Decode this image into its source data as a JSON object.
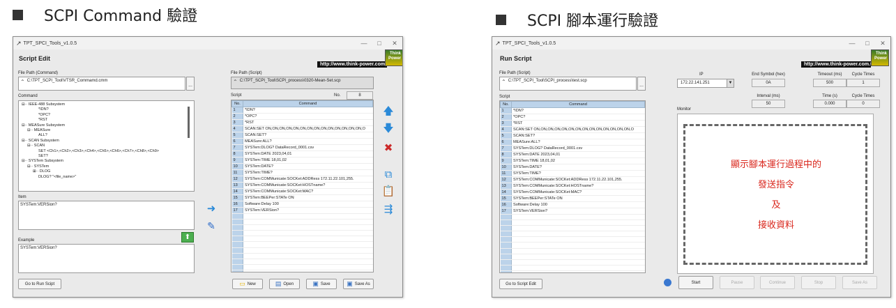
{
  "headings": {
    "left": "SCPI Command 驗證",
    "right": "SCPI 腳本運行驗證"
  },
  "common": {
    "app_title": "TPT_SPCI_Tools_v1.0.5",
    "url": "http://www.think-power.com.tw",
    "logo_text": "Think Power",
    "window_controls": [
      "—",
      "□",
      "✕"
    ]
  },
  "script_edit": {
    "title": "Script Edit",
    "file_path_command_label": "File Path (Command)",
    "file_path_command_value": "C:\\TPT_SCPI_Tool\\VTSR_Commamd.cmm",
    "browse": "...",
    "command_label": "Command",
    "command_tree": [
      {
        "text": "IEEE-488 Subsystem",
        "prefix": "⊟··",
        "indent": 0
      },
      {
        "text": "*IDN?",
        "prefix": "",
        "indent": 3
      },
      {
        "text": "*OPC?",
        "prefix": "",
        "indent": 3
      },
      {
        "text": "*RST",
        "prefix": "",
        "indent": 3
      },
      {
        "text": "MEASure Subsystem",
        "prefix": "⊟··",
        "indent": 0
      },
      {
        "text": "MEASure",
        "prefix": "⊟··",
        "indent": 1
      },
      {
        "text": "ALL?",
        "prefix": "",
        "indent": 3
      },
      {
        "text": "SCAN Subsystem",
        "prefix": "⊟··",
        "indent": 0
      },
      {
        "text": "SCAN",
        "prefix": "⊟··",
        "indent": 1
      },
      {
        "text": "SET <Ch1>,<Ch2>,<Ch3>,<Ch4>,<Ch5>,<Ch6>,<Ch7>,<Ch8>,<Ch9>",
        "prefix": "",
        "indent": 3
      },
      {
        "text": "SET?",
        "prefix": "",
        "indent": 3
      },
      {
        "text": "SYSTem Subsystem",
        "prefix": "⊟··",
        "indent": 0
      },
      {
        "text": "SYSTem",
        "prefix": "⊟··",
        "indent": 1
      },
      {
        "text": "DLOG",
        "prefix": "⊞··",
        "indent": 2
      },
      {
        "text": "DLOG? \"<file_name>\"",
        "prefix": "",
        "indent": 3
      }
    ],
    "item_label": "Item",
    "item_value": "SYSTem:VERSion?",
    "example_label": "Example",
    "example_value": "SYSTem:VERSion?",
    "goto_run": "Go to Run Scipt",
    "file_path_script_label": "File Path (Script)",
    "file_path_script_value": "C:\\TPT_SCPI_Tool\\SCPI_process\\0320-Mean-Set.scp",
    "script_label": "Script",
    "no_label": "No.",
    "no_value": "8",
    "col_no": "No.",
    "col_command": "Command",
    "buttons": {
      "new": "New",
      "open": "Open",
      "save": "Save",
      "save_as": "Save As"
    }
  },
  "script_rows": [
    {
      "no": "1",
      "cmd": "*IDN?"
    },
    {
      "no": "2",
      "cmd": "*OPC?"
    },
    {
      "no": "3",
      "cmd": "*RST"
    },
    {
      "no": "4",
      "cmd": "SCAN:SET ON,ON,ON,ON,ON,ON,ON,ON,ON,ON,ON,ON,ON,ON,O"
    },
    {
      "no": "5",
      "cmd": "SCAN:SET?"
    },
    {
      "no": "6",
      "cmd": "MEASure:ALL?"
    },
    {
      "no": "7",
      "cmd": "SYSTem:DLOG? DataRecord_0001.csv"
    },
    {
      "no": "8",
      "cmd": "SYSTem:DATE 2023,04,01"
    },
    {
      "no": "9",
      "cmd": "SYSTem:TIME 18,01,02"
    },
    {
      "no": "10",
      "cmd": "SYSTem:DATE?"
    },
    {
      "no": "11",
      "cmd": "SYSTem:TIME?"
    },
    {
      "no": "12",
      "cmd": "SYSTem:COMMunicate:SOCKet:ADDRess 172.11.22.101,255."
    },
    {
      "no": "13",
      "cmd": "SYSTem:COMMunicate:SOCKet:HOSTname?"
    },
    {
      "no": "14",
      "cmd": "SYSTem:COMMunicate:SOCKet:MAC?"
    },
    {
      "no": "15",
      "cmd": "SYSTem:BEEPer:STATe ON"
    },
    {
      "no": "16",
      "cmd": "Software:Delay 100"
    },
    {
      "no": "17",
      "cmd": "SYSTem:VERSion?"
    }
  ],
  "run_script": {
    "title": "Run Script",
    "file_path_label": "File Path (Script)",
    "file_path_value": "C:\\TPT_SCPI_Tool\\SCPI_process\\test.scp",
    "browse": "...",
    "script_label": "Script",
    "col_no": "No.",
    "col_command": "Command",
    "ip_label": "IP",
    "ip_value": "172.22.141.251",
    "end_symbol_label": "End Symbol (hex)",
    "end_symbol_value": "0A",
    "timeout_label": "Timeout (ms)",
    "timeout_value": "500",
    "cycle_times_label": "Cycle Times",
    "cycle_times_value": "1",
    "interval_label": "Interval (ms)",
    "interval_value": "50",
    "time_label": "Time (s)",
    "time_value": "0.000",
    "cycle_times2_label": "Cycle Times",
    "cycle_times2_value": "0",
    "monitor_label": "Monitor",
    "monitor_text": [
      "顯示腳本運行過程中的",
      "發送指令",
      "及",
      "接收資料"
    ],
    "goto_edit": "Go to Script Edit",
    "buttons": {
      "start": "Start",
      "pause": "Pause",
      "continue": "Continue",
      "stop": "Stop",
      "save_as": "Save As"
    }
  },
  "colors": {
    "header_blue": "#bcd3ea",
    "annotation_red": "#d9261c",
    "accent_blue": "#2b8ad8",
    "delete_red": "#cc2a2a"
  }
}
